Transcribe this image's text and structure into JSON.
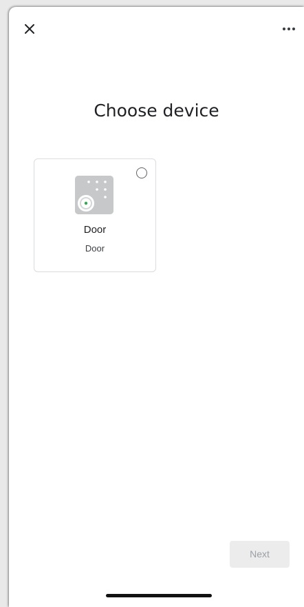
{
  "header": {
    "close_icon": "close-icon",
    "more_icon": "more-horizontal-icon"
  },
  "page": {
    "title": "Choose device"
  },
  "devices": [
    {
      "name": "Door",
      "room": "Door",
      "icon": "door-lock-keypad-icon",
      "selected": false
    }
  ],
  "footer": {
    "next_label": "Next",
    "next_enabled": false
  },
  "colors": {
    "accent_green": "#34a853",
    "disabled_button_bg": "#ececec",
    "disabled_button_text": "#9aa0a6",
    "card_border": "#dadce0"
  }
}
